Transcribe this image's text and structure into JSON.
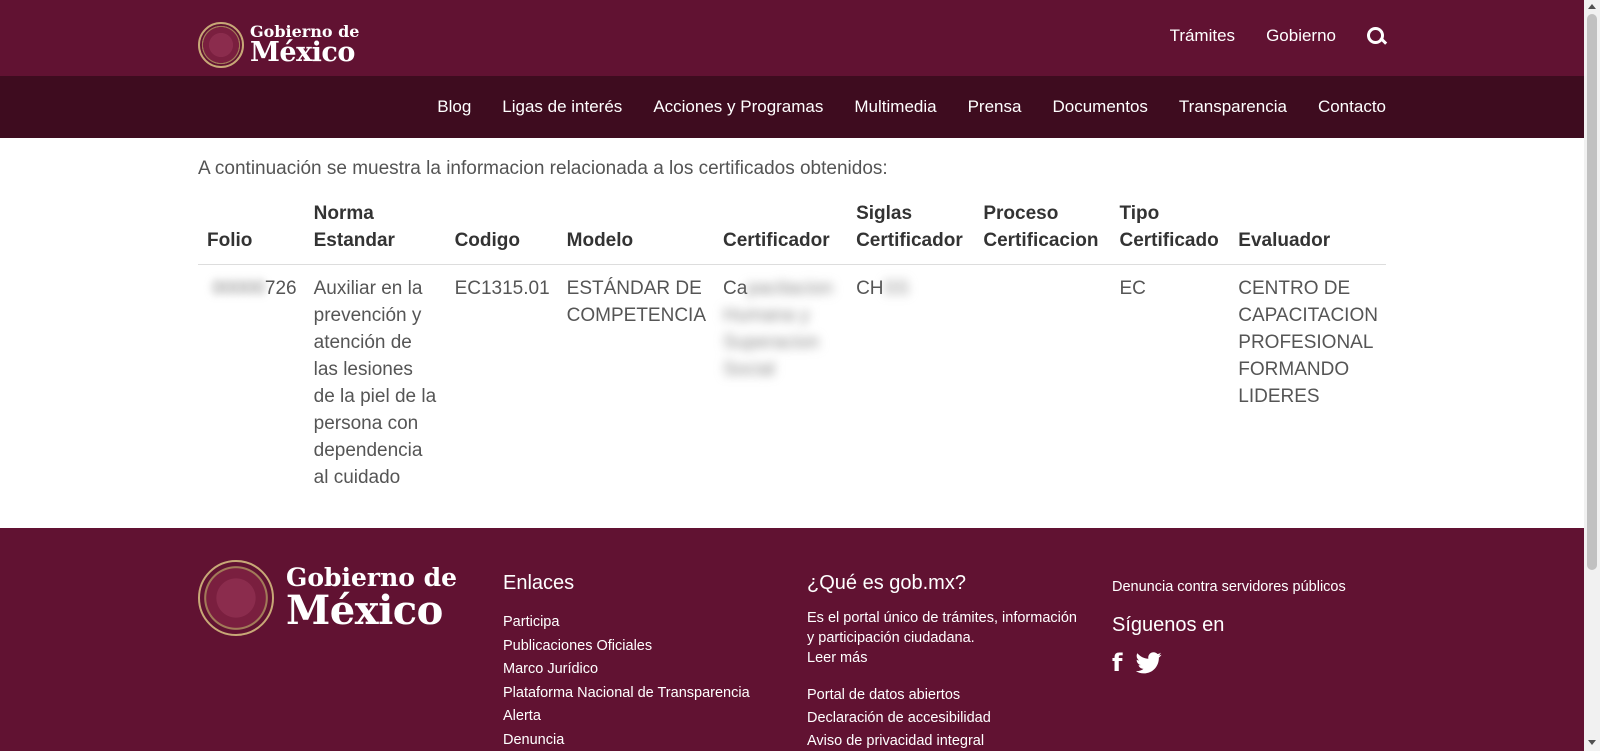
{
  "header": {
    "logo_small": "Gobierno de",
    "logo_big": "México",
    "top_links": [
      "Trámites",
      "Gobierno"
    ],
    "search_icon": "search-icon"
  },
  "subnav": {
    "items": [
      "Blog",
      "Ligas de interés",
      "Acciones y Programas",
      "Multimedia",
      "Prensa",
      "Documentos",
      "Transparencia",
      "Contacto"
    ]
  },
  "main": {
    "intro": "A continuación se muestra la informacion relacionada a los certificados obtenidos:",
    "table": {
      "headers": [
        "Folio",
        "Norma Estandar",
        "Codigo",
        "Modelo",
        "Certificador",
        "Siglas Certificador",
        "Proceso Certificacion",
        "Tipo Certificado",
        "Evaluador"
      ],
      "row": {
        "folio": "726",
        "norma": "Auxiliar en la prevención y atención de las lesiones de la piel de la persona con dependencia al cuidado",
        "codigo": "EC1315.01",
        "modelo": "ESTÁNDAR DE COMPETENCIA",
        "certificador": "Ca",
        "siglas": "CH",
        "proceso": "",
        "tipo": "EC",
        "evaluador": "CENTRO DE CAPACITACION PROFESIONAL FORMANDO LIDERES"
      }
    }
  },
  "footer": {
    "logo_small": "Gobierno de",
    "logo_big": "México",
    "enlaces": {
      "heading": "Enlaces",
      "items": [
        "Participa",
        "Publicaciones Oficiales",
        "Marco Jurídico",
        "Plataforma Nacional de Transparencia",
        "Alerta",
        "Denuncia"
      ]
    },
    "que_es": {
      "heading": "¿Qué es gob.mx?",
      "description": "Es el portal único de trámites, información y participación ciudadana.",
      "read_more": "Leer más",
      "items": [
        "Portal de datos abiertos",
        "Declaración de accesibilidad",
        "Aviso de privacidad integral"
      ]
    },
    "right": {
      "denuncia": "Denuncia contra servidores públicos",
      "siguenos": "Síguenos en",
      "facebook": "f"
    }
  },
  "colors": {
    "primary": "#611232",
    "secondary": "#3e0c1f"
  }
}
